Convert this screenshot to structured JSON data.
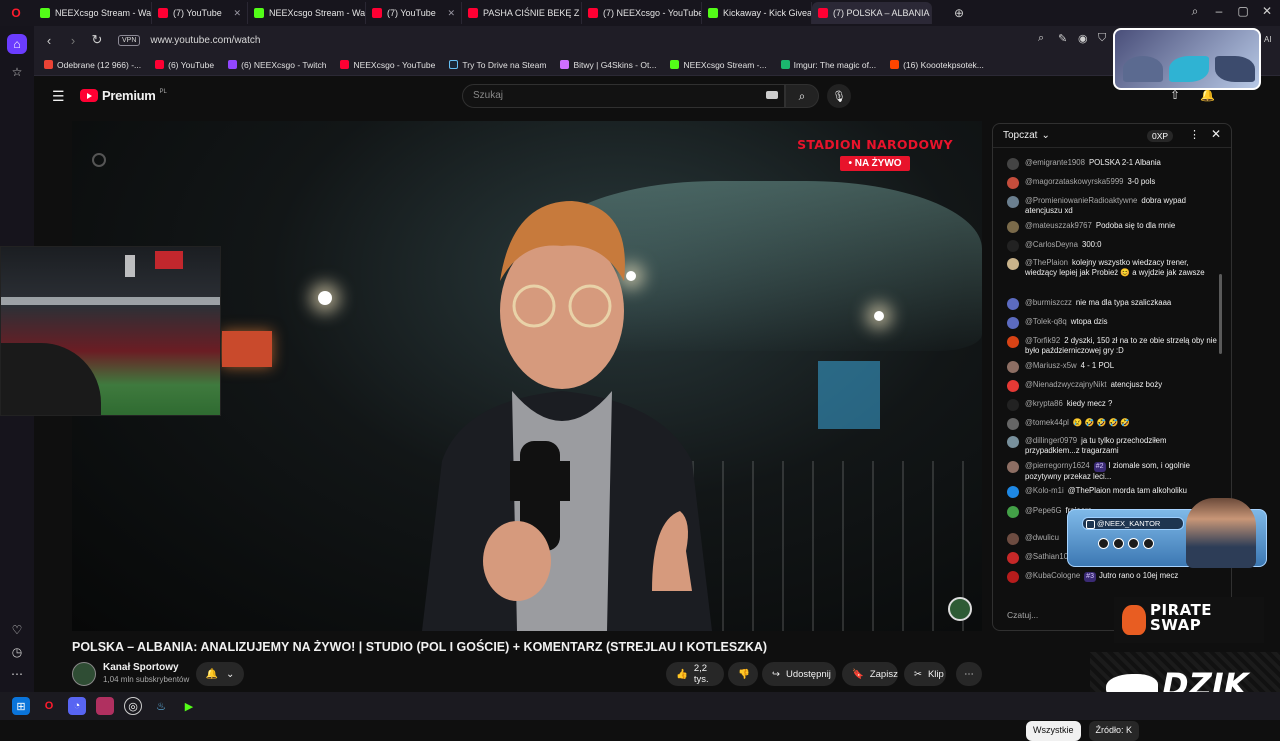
{
  "tabs": [
    {
      "label": "NEEXcsgo Stream - Watch",
      "icon": "kick"
    },
    {
      "label": "(7) YouTube",
      "icon": "yt"
    },
    {
      "label": "NEEXcsgo Stream - Watch",
      "icon": "kick"
    },
    {
      "label": "(7) YouTube",
      "icon": "yt"
    },
    {
      "label": "PASHA CIŚNIE BEKĘ Z NIC",
      "icon": "yt"
    },
    {
      "label": "(7) NEEXcsgo - YouTube",
      "icon": "yt"
    },
    {
      "label": "Kickaway - Kick Giveaway",
      "icon": "kick"
    },
    {
      "label": "(7) POLSKA – ALBANIA",
      "icon": "yt"
    }
  ],
  "address": {
    "vpn": "VPN",
    "url": "www.youtube.com/watch"
  },
  "bookmarks": [
    "Odebrane (12 966) -...",
    "(6) YouTube",
    "(6) NEEXcsgo - Twitch",
    "NEEXcsgo - YouTube",
    "Try To Drive na Steam",
    "Bitwy | G4Skins - Ot...",
    "NEEXcsgo Stream -...",
    "Imgur: The magic of...",
    "(16) Koootekpsotek..."
  ],
  "youtube": {
    "logo": "Premium",
    "logo_country": "PL",
    "search_placeholder": "Szukaj"
  },
  "video": {
    "overlay_title": "STADION NARODOWY",
    "overlay_live": "• NA ŻYWO",
    "title": "POLSKA – ALBANIA: ANALIZUJEMY NA ŻYWO! | STUDIO (POL I GOŚCIE) + KOMENTARZ (STREJLAU I KOTLESZKA)",
    "channel": "Kanał Sportowy",
    "subs": "1,04 mln subskrybentów",
    "likes": "2,2 tys.",
    "share": "Udostępnij",
    "save": "Zapisz",
    "clip": "Klip"
  },
  "chat": {
    "mode": "Topczat",
    "xp": "0XP",
    "input_placeholder": "Czatuj...",
    "messages": [
      {
        "author": "@emigrante1908",
        "text": "POLSKA 2-1 Albania",
        "color": "#444"
      },
      {
        "author": "@magorzataskowyrska5999",
        "text": "3-0 pols",
        "color": "#c44d3c"
      },
      {
        "author": "@PromieniowanieRadioaktywne",
        "text": "dobra wypad atencjuszu xd",
        "color": "#6b7f8f"
      },
      {
        "author": "@mateuszzak9767",
        "text": "Podoba się to dla mnie",
        "color": "#7a6a4a"
      },
      {
        "author": "@CarlosDeyna",
        "text": "300:0",
        "color": "#222"
      },
      {
        "author": "@ThePlaion",
        "text": "kolejny wszystko wiedzacy trener, wiedzący lepiej jak Probież 😊 a wyjdzie jak zawsze",
        "color": "#c9b38b"
      },
      {
        "author": "@burmiszczz",
        "text": "nie ma dla typa szaliczkaaa",
        "color": "#5c6bc0"
      },
      {
        "author": "@Tolek-q8q",
        "text": "wtopa dzis",
        "color": "#5c6bc0"
      },
      {
        "author": "@Torfik92",
        "text": "2 dyszki, 150 zł na to ze obie strzelą oby nie było październiczowej gry :D",
        "color": "#d84315"
      },
      {
        "author": "@Mariusz-x5w",
        "text": "4 - 1 POL",
        "color": "#8d6e63"
      },
      {
        "author": "@NienadzwyczajnyNikt",
        "text": "atencjusz boży",
        "color": "#e53935"
      },
      {
        "author": "@krypta86",
        "text": "kiedy mecz ?",
        "color": "#222"
      },
      {
        "author": "@tomek44pl",
        "text": "😢 🤣 🤣 🤣 🤣",
        "color": "#666"
      },
      {
        "author": "@dillinger0979",
        "text": "ja tu tylko przechodziłem przypadkiem...z tragarzami",
        "color": "#78909c"
      },
      {
        "author": "@pierregorny1624",
        "badge": "#2",
        "text": "I ziomale som, i ogolnie pozytywny przekaz leci...",
        "color": "#8d6e63"
      },
      {
        "author": "@Kolo-m1i",
        "text": "@ThePlaion morda tam alkoholiku",
        "color": "#1e88e5"
      },
      {
        "author": "@Pepe6G",
        "text": "frajeera",
        "color": "#43a047"
      },
      {
        "author": "@dwulicu",
        "text": "",
        "color": "#6d4c41"
      },
      {
        "author": "@Sathian10",
        "text": "",
        "color": "#c62828"
      },
      {
        "author": "@KubaCologne",
        "badge": "#3",
        "text": "Jutro rano o 10ej mecz",
        "color": "#b71c1c"
      }
    ]
  },
  "overlays": {
    "handle": "@NEEX_KANTOR",
    "pirate": "PIRATE SWAP",
    "dzik": "DZIK"
  },
  "filters": [
    "Wszystkie",
    "Źródło: K"
  ]
}
